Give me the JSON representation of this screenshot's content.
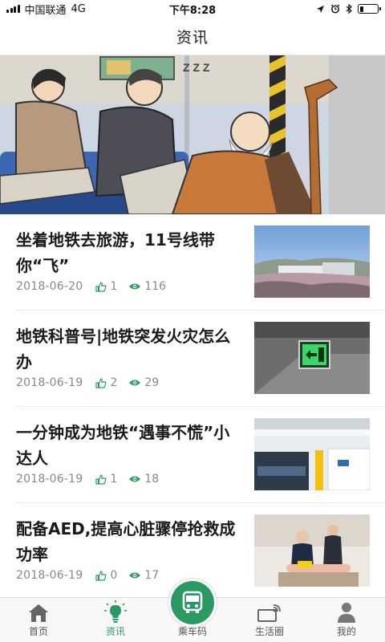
{
  "status_bar": {
    "carrier": "中国联通",
    "network": "4G",
    "time": "下午8:28"
  },
  "nav": {
    "title": "资讯"
  },
  "banner": {
    "icon": "comic-illustration"
  },
  "news": [
    {
      "title": "坐着地铁去旅游，11号线带你“飞”",
      "date": "2018-06-20",
      "likes": "1",
      "views": "116"
    },
    {
      "title": "地铁科普号|地铁突发火灾怎么办",
      "date": "2018-06-19",
      "likes": "2",
      "views": "29"
    },
    {
      "title": "一分钟成为地铁“遇事不慌”小达人",
      "date": "2018-06-19",
      "likes": "1",
      "views": "18"
    },
    {
      "title": "配备AED,提高心脏骤停抢救成功率",
      "date": "2018-06-19",
      "likes": "0",
      "views": "17"
    }
  ],
  "tabs": [
    {
      "label": "首页",
      "icon": "home-icon"
    },
    {
      "label": "资讯",
      "icon": "lightbulb-icon"
    },
    {
      "label": "乘车码",
      "icon": "bus-icon"
    },
    {
      "label": "生活圈",
      "icon": "life-circle-icon"
    },
    {
      "label": "我的",
      "icon": "person-icon"
    }
  ],
  "colors": {
    "accent": "#2a9a62",
    "text": "#1a1a1a",
    "meta": "#888888"
  }
}
